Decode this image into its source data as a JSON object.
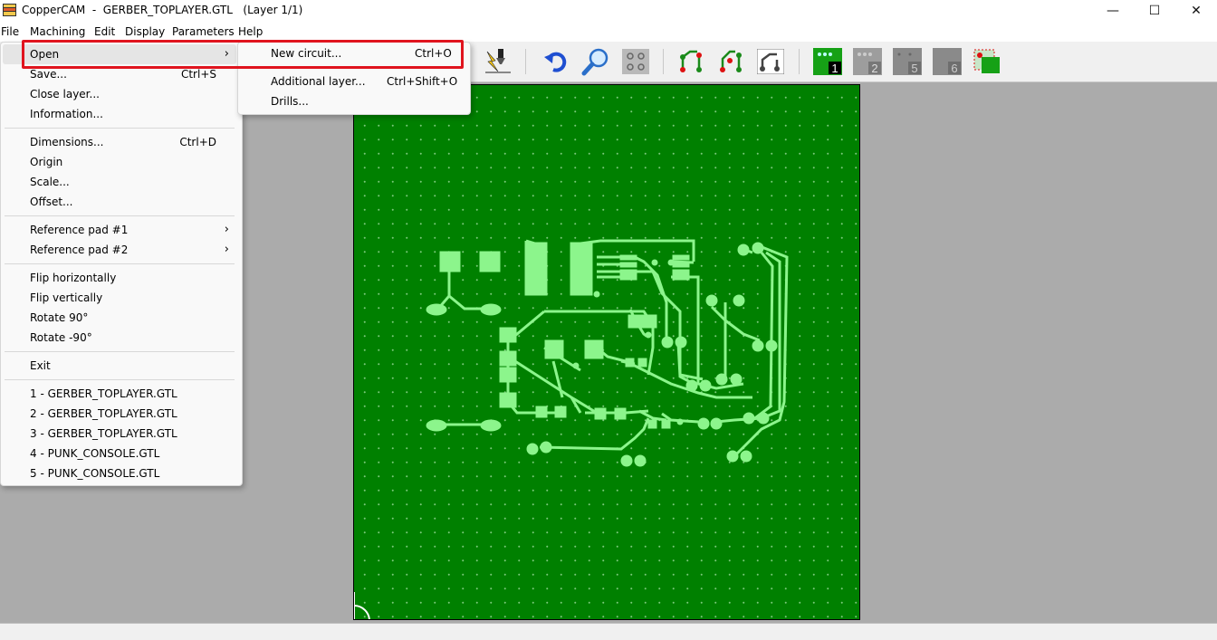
{
  "window": {
    "title": "CopperCAM  -  GERBER_TOPLAYER.GTL   (Layer 1/1)",
    "minimize_glyph": "—",
    "maximize_glyph": "☐",
    "close_glyph": "✕"
  },
  "menubar": {
    "file": "File",
    "machining": "Machining",
    "edit": "Edit",
    "display": "Display",
    "parameters": "Parameters",
    "help": "Help"
  },
  "toolbar": {
    "layer_buttons": [
      "1",
      "2",
      "5",
      "6"
    ],
    "icons": [
      "machining-tool-icon",
      "undo-icon",
      "zoom-icon",
      "pads-icon",
      "tracks-icon",
      "tracks-alt-icon",
      "circuit-icon",
      "layer-1-icon",
      "layer-2-icon",
      "layer-5-icon",
      "layer-6-icon",
      "layer-view-icon"
    ]
  },
  "file_menu": {
    "open": {
      "label": "Open",
      "arrow": "›"
    },
    "save": {
      "label": "Save...",
      "shortcut": "Ctrl+S"
    },
    "close_layer": {
      "label": "Close layer..."
    },
    "information": {
      "label": "Information..."
    },
    "dimensions": {
      "label": "Dimensions...",
      "shortcut": "Ctrl+D"
    },
    "origin": {
      "label": "Origin"
    },
    "scale": {
      "label": "Scale..."
    },
    "offset": {
      "label": "Offset..."
    },
    "ref_pad_1": {
      "label": "Reference pad #1",
      "arrow": "›"
    },
    "ref_pad_2": {
      "label": "Reference pad #2",
      "arrow": "›"
    },
    "flip_h": {
      "label": "Flip horizontally"
    },
    "flip_v": {
      "label": "Flip vertically"
    },
    "rotate_90": {
      "label": "Rotate 90°"
    },
    "rotate_neg90": {
      "label": "Rotate -90°"
    },
    "exit": {
      "label": "Exit"
    },
    "recent": [
      "1 - GERBER_TOPLAYER.GTL",
      "2 - GERBER_TOPLAYER.GTL",
      "3 - GERBER_TOPLAYER.GTL",
      "4 - PUNK_CONSOLE.GTL",
      "5 - PUNK_CONSOLE.GTL"
    ]
  },
  "open_submenu": {
    "new_circuit": {
      "label": "New circuit...",
      "shortcut": "Ctrl+O"
    },
    "additional_layer": {
      "label": "Additional layer...",
      "shortcut": "Ctrl+Shift+O"
    },
    "drills": {
      "label": "Drills..."
    }
  },
  "colors": {
    "board": "#008000",
    "copper": "#8cf58c",
    "highlight_box": "#e0141e"
  }
}
